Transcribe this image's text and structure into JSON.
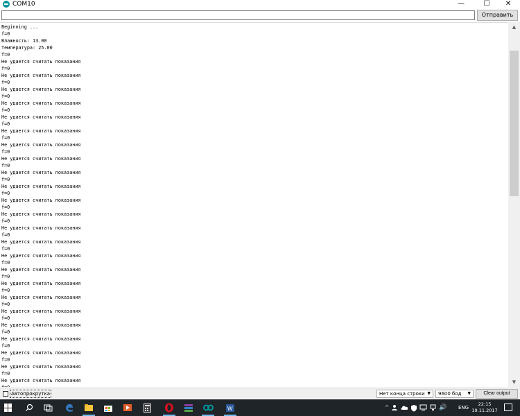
{
  "window": {
    "title": "COM10",
    "minimize_glyph": "—",
    "maximize_glyph": "☐",
    "close_glyph": "✕"
  },
  "send": {
    "input_value": "",
    "button_label": "Отправить"
  },
  "output": {
    "lines": [
      "Beginning ...",
      "f=0",
      "Влажность: 13.00",
      "Температура: 25.00",
      "f=0",
      "Не удается считать показания",
      "f=0",
      "Не удается считать показания",
      "f=0",
      "Не удается считать показания",
      "f=0",
      "Не удается считать показания",
      "f=0",
      "Не удается считать показания",
      "f=0",
      "Не удается считать показания",
      "f=0",
      "Не удается считать показания",
      "f=0",
      "Не удается считать показания",
      "f=0",
      "Не удается считать показания",
      "f=0",
      "Не удается считать показания",
      "f=0",
      "Не удается считать показания",
      "f=0",
      "Не удается считать показания",
      "f=0",
      "Не удается считать показания",
      "f=0",
      "Не удается считать показания",
      "f=0",
      "Не удается считать показания",
      "f=0",
      "Не удается считать показания",
      "f=0",
      "Не удается считать показания",
      "f=0",
      "Не удается считать показания",
      "f=0",
      "Не удается считать показания",
      "f=0",
      "Не удается считать показания",
      "f=0",
      "Не удается считать показания",
      "f=0",
      "Не удается считать показания",
      "f=0",
      "Не удается считать показания",
      "f=0",
      "Не удается считать показания",
      "f=0"
    ]
  },
  "scrollbar": {
    "up_glyph": "▲",
    "down_glyph": "▼"
  },
  "bottom": {
    "autoscroll_label": "Автопрокрутка",
    "autoscroll_checked": false,
    "line_ending": "Нет конца строки",
    "baud": "9600 бод",
    "dropdown_glyph": "▼",
    "clear_label": "Clear output"
  },
  "taskbar": {
    "language": "ENG",
    "time": "22:15",
    "date": "19.11.2017",
    "tray_chevron": "^",
    "volume_glyph": "🔊"
  }
}
